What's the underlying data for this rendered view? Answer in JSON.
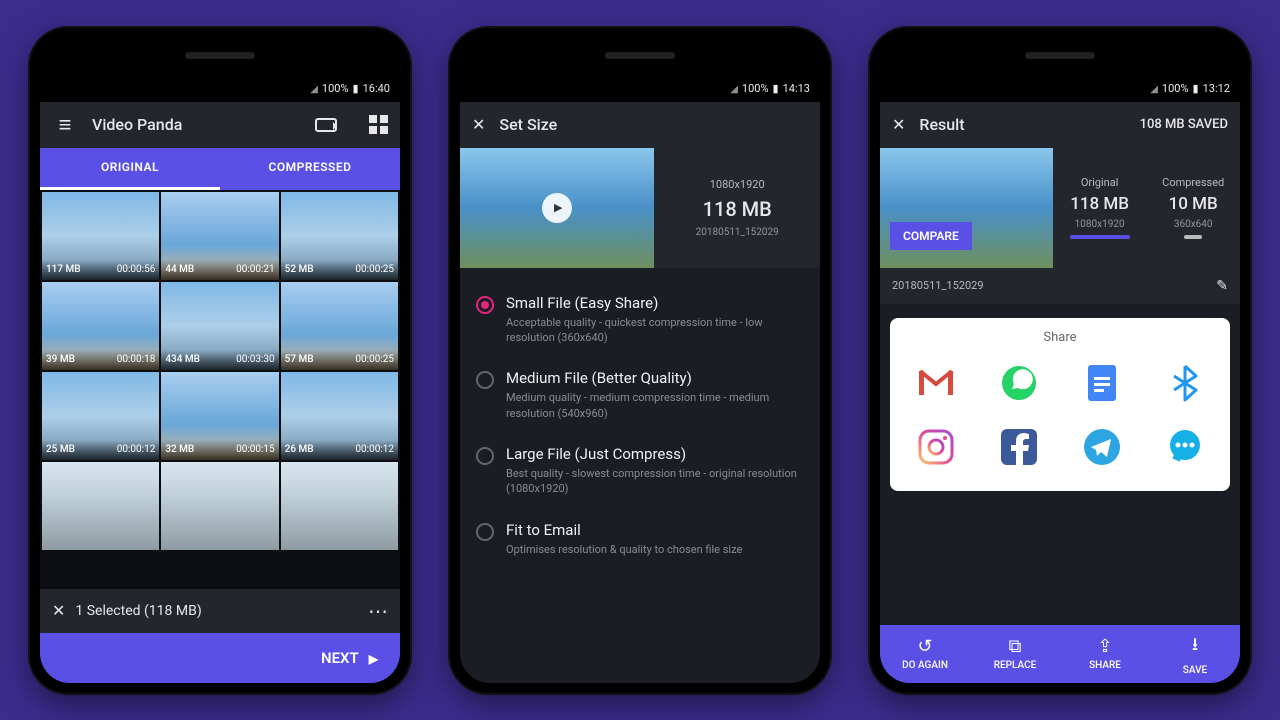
{
  "status": {
    "battery": "100%"
  },
  "phone1": {
    "time": "16:40",
    "title": "Video Panda",
    "tabs": {
      "original": "ORIGINAL",
      "compressed": "COMPRESSED"
    },
    "thumbs": [
      {
        "size": "117 MB",
        "dur": "00:00:56"
      },
      {
        "size": "44 MB",
        "dur": "00:00:21"
      },
      {
        "size": "52 MB",
        "dur": "00:00:25"
      },
      {
        "size": "39 MB",
        "dur": "00:00:18"
      },
      {
        "size": "434 MB",
        "dur": "00:03:30"
      },
      {
        "size": "57 MB",
        "dur": "00:00:25"
      },
      {
        "size": "25 MB",
        "dur": "00:00:12"
      },
      {
        "size": "32 MB",
        "dur": "00:00:15"
      },
      {
        "size": "26 MB",
        "dur": "00:00:12"
      }
    ],
    "selection": "1 Selected (118 MB)",
    "next": "NEXT"
  },
  "phone2": {
    "time": "14:13",
    "title": "Set Size",
    "resolution": "1080x1920",
    "filesize": "118 MB",
    "filename": "20180511_152029",
    "options": [
      {
        "title": "Small File (Easy Share)",
        "desc": "Acceptable quality - quickest compression time - low resolution (360x640)",
        "selected": true
      },
      {
        "title": "Medium File (Better Quality)",
        "desc": "Medium quality - medium compression time - medium resolution (540x960)",
        "selected": false
      },
      {
        "title": "Large File (Just Compress)",
        "desc": "Best quality - slowest compression time - original resolution (1080x1920)",
        "selected": false
      },
      {
        "title": "Fit to Email",
        "desc": "Optimises resolution & quality to chosen file size",
        "selected": false
      }
    ]
  },
  "phone3": {
    "time": "13:12",
    "title": "Result",
    "saved": "108 MB SAVED",
    "compare": "COMPARE",
    "original": {
      "label": "Original",
      "size": "118 MB",
      "res": "1080x1920"
    },
    "compressed": {
      "label": "Compressed",
      "size": "10 MB",
      "res": "360x640"
    },
    "filename": "20180511_152029",
    "share_label": "Share",
    "share_icons": [
      "gmail",
      "whatsapp",
      "docs",
      "bluetooth",
      "instagram",
      "facebook",
      "telegram",
      "messages"
    ],
    "actions": {
      "again": "DO AGAIN",
      "replace": "REPLACE",
      "share": "SHARE",
      "save": "SAVE"
    }
  }
}
